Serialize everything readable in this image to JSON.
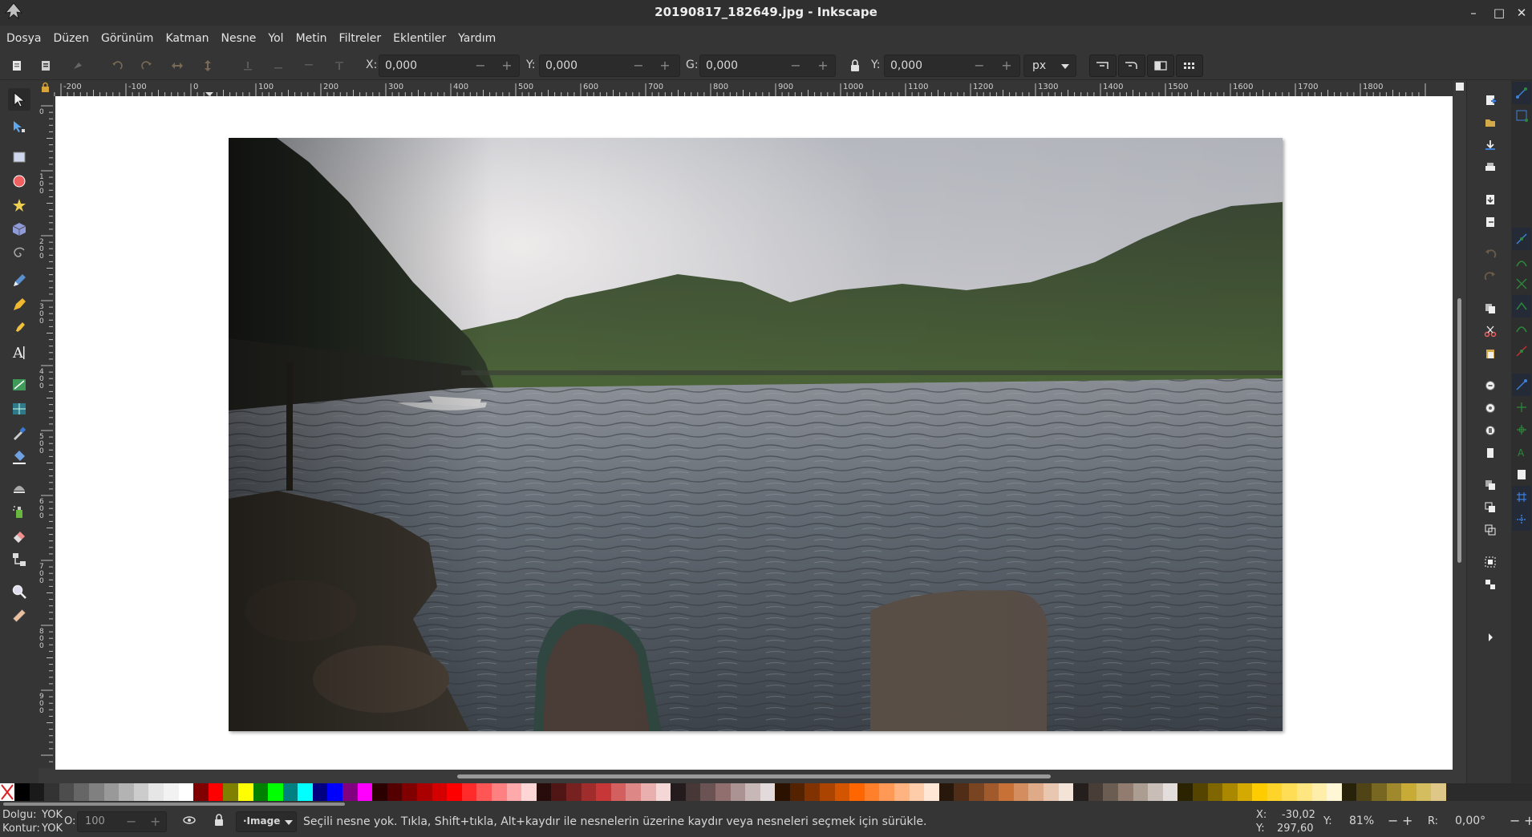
{
  "window": {
    "title": "20190817_182649.jpg - Inkscape",
    "minimize": "–",
    "maximize": "□",
    "close": "✕"
  },
  "menu": {
    "items": [
      "Dosya",
      "Düzen",
      "Görünüm",
      "Katman",
      "Nesne",
      "Yol",
      "Metin",
      "Filtreler",
      "Eklentiler",
      "Yardım"
    ]
  },
  "toolbar": {
    "x_label": "X:",
    "x_value": "0,000",
    "y_label": "Y:",
    "y_value": "0,000",
    "w_label": "G:",
    "w_value": "0,000",
    "h_label": "Y:",
    "h_value": "0,000",
    "unit": "px",
    "minus": "−",
    "plus": "+"
  },
  "ruler": {
    "h_labels": [
      "-200",
      "-100",
      "0",
      "100",
      "200",
      "300",
      "400",
      "500",
      "600",
      "700",
      "800",
      "900",
      "1000",
      "1100",
      "1200",
      "1300",
      "1400",
      "1500",
      "1600",
      "1700",
      "1800"
    ],
    "v_labels": [
      "0",
      "100",
      "200",
      "300",
      "400",
      "500",
      "600",
      "700",
      "800",
      "900"
    ]
  },
  "colors": {
    "accent_blue": "#3d7fd9",
    "ui_dark": "#353535",
    "canvas": "#ffffff"
  },
  "palette": {
    "colors": [
      "#000000",
      "#1a1a1a",
      "#333333",
      "#4d4d4d",
      "#666666",
      "#808080",
      "#999999",
      "#b3b3b3",
      "#cccccc",
      "#e6e6e6",
      "#f2f2f2",
      "#ffffff",
      "#800000",
      "#ff0000",
      "#808000",
      "#ffff00",
      "#008000",
      "#00ff00",
      "#008080",
      "#00ffff",
      "#000080",
      "#0000ff",
      "#800080",
      "#ff00ff",
      "#2b0000",
      "#550000",
      "#800000",
      "#aa0000",
      "#d40000",
      "#ff0000",
      "#ff2a2a",
      "#ff5555",
      "#ff8080",
      "#ffaaaa",
      "#ffd5d5",
      "#280b0b",
      "#501616",
      "#782121",
      "#a02c2c",
      "#c83737",
      "#d35f5f",
      "#de8787",
      "#e9afaf",
      "#f4d7d7",
      "#241c1c",
      "#483737",
      "#6c5353",
      "#916f6f",
      "#ac9393",
      "#c8b7b7",
      "#e3dbdb",
      "#2b1100",
      "#552200",
      "#803300",
      "#aa4400",
      "#d45500",
      "#ff6600",
      "#ff7f2a",
      "#ff9955",
      "#ffb380",
      "#ffccaa",
      "#ffe6d5",
      "#28170b",
      "#502d16",
      "#784421",
      "#a05a2c",
      "#c87137",
      "#d38d5f",
      "#deaa87",
      "#e9c6af",
      "#f4e3d7",
      "#241f1c",
      "#483e37",
      "#6c5d53",
      "#917c6f",
      "#ac9d93",
      "#c8beb7",
      "#e3dedb",
      "#2b2200",
      "#554400",
      "#806600",
      "#aa8800",
      "#d4aa00",
      "#ffcc00",
      "#ffd42a",
      "#ffdd55",
      "#ffe680",
      "#ffeeaa",
      "#fff6d5",
      "#28220b",
      "#504416",
      "#786721",
      "#a0892c",
      "#c8ab37",
      "#d4bd5f",
      "#dec787"
    ]
  },
  "status": {
    "fill_label": "Dolgu:",
    "fill_value": "YOK",
    "stroke_label": "Kontur:",
    "stroke_value": "YOK",
    "opacity_label": "O:",
    "opacity_value": "100",
    "layer": "·Image",
    "message": "Seçili nesne yok. Tıkla, Shift+tıkla, Alt+kaydır ile nesnelerin üzerine kaydır veya nesneleri seçmek için sürükle.",
    "cursor_x_label": "X:",
    "cursor_x": "-30,02",
    "cursor_y_label": "Y:",
    "cursor_y": "297,60",
    "zoom_label": "Y:",
    "zoom": "81%",
    "rotate_label": "R:",
    "rotate": "0,00°"
  }
}
